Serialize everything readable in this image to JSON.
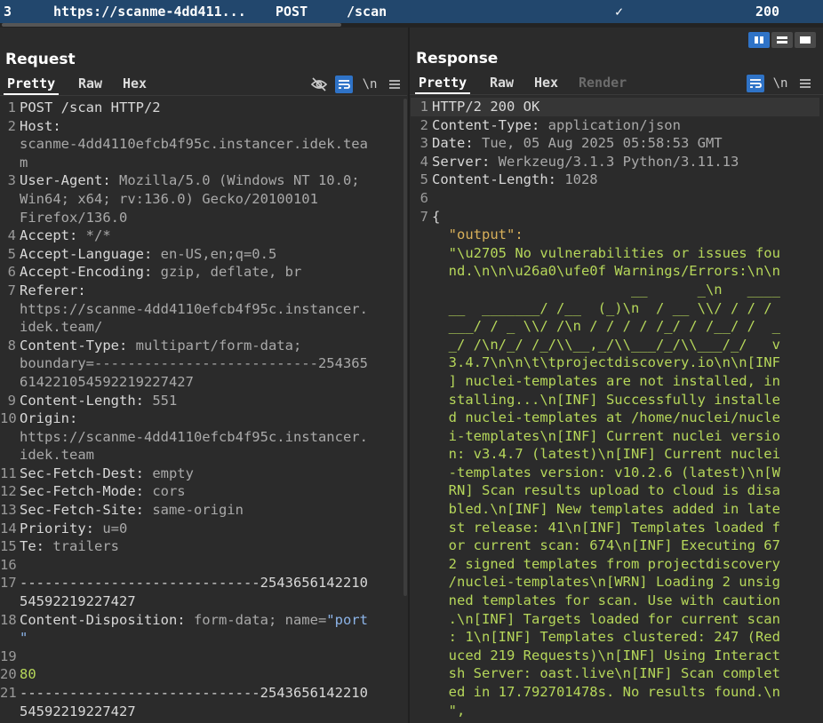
{
  "history_row": {
    "index": "3",
    "host": "https://scanme-4dd411...",
    "method": "POST",
    "path": "/scan",
    "edited_mark": "✓",
    "status": "200"
  },
  "layout_toggle": [
    "side-by-side",
    "stacked",
    "tabs"
  ],
  "request": {
    "title": "Request",
    "tabs": [
      "Pretty",
      "Raw",
      "Hex"
    ],
    "active_tab": "Pretty",
    "icons": [
      "hide-nonprintable-icon",
      "wrap-lines-icon",
      "newline-icon",
      "menu-icon"
    ],
    "newline_label": "\\n",
    "line_numbers": [
      "1",
      "2",
      "",
      "",
      "3",
      "",
      "",
      "4",
      "5",
      "6",
      "7",
      "",
      "",
      "8",
      "",
      "",
      "9",
      "10",
      "",
      "",
      "11",
      "12",
      "13",
      "14",
      "15",
      "16",
      "17",
      "",
      "18",
      "",
      "19",
      "20",
      "21",
      ""
    ],
    "lines": [
      [
        [
          "POST /scan HTTP/2",
          "hname"
        ]
      ],
      [
        [
          "Host:",
          "hname"
        ]
      ],
      [
        [
          "scanme-4dd4110efcb4f95c.instancer.idek.tea",
          "hval"
        ]
      ],
      [
        [
          "m",
          "hval"
        ]
      ],
      [
        [
          "User-Agent:",
          "hname"
        ],
        [
          " Mozilla/5.0 (Windows NT 10.0;",
          "hval"
        ]
      ],
      [
        [
          "Win64; x64; rv:136.0) Gecko/20100101",
          "hval"
        ]
      ],
      [
        [
          "Firefox/136.0",
          "hval"
        ]
      ],
      [
        [
          "Accept:",
          "hname"
        ],
        [
          " */*",
          "hval"
        ]
      ],
      [
        [
          "Accept-Language:",
          "hname"
        ],
        [
          " en-US,en;q=0.5",
          "hval"
        ]
      ],
      [
        [
          "Accept-Encoding:",
          "hname"
        ],
        [
          " gzip, deflate, br",
          "hval"
        ]
      ],
      [
        [
          "Referer:",
          "hname"
        ]
      ],
      [
        [
          "https://scanme-4dd4110efcb4f95c.instancer.",
          "hval"
        ]
      ],
      [
        [
          "idek.team/",
          "hval"
        ]
      ],
      [
        [
          "Content-Type:",
          "hname"
        ],
        [
          " multipart/form-data;",
          "hval"
        ]
      ],
      [
        [
          "boundary=---------------------------254365",
          "hval"
        ]
      ],
      [
        [
          "614221054592219227427",
          "hval"
        ]
      ],
      [
        [
          "Content-Length:",
          "hname"
        ],
        [
          " 551",
          "hval"
        ]
      ],
      [
        [
          "Origin:",
          "hname"
        ]
      ],
      [
        [
          "https://scanme-4dd4110efcb4f95c.instancer.",
          "hval"
        ]
      ],
      [
        [
          "idek.team",
          "hval"
        ]
      ],
      [
        [
          "Sec-Fetch-Dest:",
          "hname"
        ],
        [
          " empty",
          "hval"
        ]
      ],
      [
        [
          "Sec-Fetch-Mode:",
          "hname"
        ],
        [
          " cors",
          "hval"
        ]
      ],
      [
        [
          "Sec-Fetch-Site:",
          "hname"
        ],
        [
          " same-origin",
          "hval"
        ]
      ],
      [
        [
          "Priority:",
          "hname"
        ],
        [
          " u=0",
          "hval"
        ]
      ],
      [
        [
          "Te:",
          "hname"
        ],
        [
          " trailers",
          "hval"
        ]
      ],
      [
        [
          "",
          "plain"
        ]
      ],
      [
        [
          "-----------------------------2543656142210",
          "plain"
        ]
      ],
      [
        [
          "54592219227427",
          "plain"
        ]
      ],
      [
        [
          "Content-Disposition:",
          "hname"
        ],
        [
          " form-data; name=",
          "hval"
        ],
        [
          "\"port",
          "attr"
        ]
      ],
      [
        [
          "\"",
          "attr"
        ]
      ],
      [
        [
          "",
          "plain"
        ]
      ],
      [
        [
          "80",
          "green"
        ]
      ],
      [
        [
          "-----------------------------2543656142210",
          "plain"
        ]
      ],
      [
        [
          "54592219227427",
          "plain"
        ]
      ]
    ]
  },
  "response": {
    "title": "Response",
    "tabs": [
      "Pretty",
      "Raw",
      "Hex",
      "Render"
    ],
    "active_tab": "Pretty",
    "icons": [
      "wrap-lines-icon",
      "newline-icon",
      "menu-icon"
    ],
    "newline_label": "\\n",
    "line_numbers": [
      "1",
      "2",
      "3",
      "4",
      "5",
      "6",
      "7",
      "",
      "",
      "",
      "",
      "",
      "",
      "",
      "",
      "",
      "",
      "",
      "",
      "",
      "",
      "",
      "",
      "",
      "",
      "",
      "",
      "",
      "",
      "",
      "",
      "",
      "",
      "",
      "",
      "",
      "",
      "",
      "",
      ""
    ],
    "lines": [
      [
        [
          "HTTP/2 200 OK",
          "hname"
        ]
      ],
      [
        [
          "Content-Type:",
          "hname"
        ],
        [
          " application/json",
          "hval"
        ]
      ],
      [
        [
          "Date:",
          "hname"
        ],
        [
          " Tue, 05 Aug 2025 05:58:53 GMT",
          "hval"
        ]
      ],
      [
        [
          "Server:",
          "hname"
        ],
        [
          " Werkzeug/3.1.3 Python/3.11.13",
          "hval"
        ]
      ],
      [
        [
          "Content-Length:",
          "hname"
        ],
        [
          " 1028",
          "hval"
        ]
      ],
      [
        [
          "",
          "plain"
        ]
      ],
      [
        [
          "{",
          "plain"
        ]
      ],
      [
        [
          "  \"output\":",
          "json-key"
        ]
      ],
      [
        [
          "  \"\\u2705 No vulnerabilities or issues fou",
          "green"
        ]
      ],
      [
        [
          "  nd.\\n\\n\\u26a0\\ufe0f Warnings/Errors:\\n\\n",
          "green"
        ]
      ],
      [
        [
          "                        __      _\\n   ____",
          "green"
        ]
      ],
      [
        [
          "  __  _______/ /__  (_)\\n  / __ \\\\/ / / /",
          "green"
        ]
      ],
      [
        [
          "  ___/ / _ \\\\/ /\\n / / / / /_/ / /__/ /  _",
          "green"
        ]
      ],
      [
        [
          "  _/ /\\n/_/ /_/\\\\__,_/\\\\___/_/\\\\___/_/   v",
          "green"
        ]
      ],
      [
        [
          "  3.4.7\\n\\n\\t\\tprojectdiscovery.io\\n\\n[INF",
          "green"
        ]
      ],
      [
        [
          "  ] nuclei-templates are not installed, in",
          "green"
        ]
      ],
      [
        [
          "  stalling...\\n[INF] Successfully installe",
          "green"
        ]
      ],
      [
        [
          "  d nuclei-templates at /home/nuclei/nucle",
          "green"
        ]
      ],
      [
        [
          "  i-templates\\n[INF] Current nuclei versio",
          "green"
        ]
      ],
      [
        [
          "  n: v3.4.7 (latest)\\n[INF] Current nuclei",
          "green"
        ]
      ],
      [
        [
          "  -templates version: v10.2.6 (latest)\\n[W",
          "green"
        ]
      ],
      [
        [
          "  RN] Scan results upload to cloud is disa",
          "green"
        ]
      ],
      [
        [
          "  bled.\\n[INF] New templates added in late",
          "green"
        ]
      ],
      [
        [
          "  st release: 41\\n[INF] Templates loaded f",
          "green"
        ]
      ],
      [
        [
          "  or current scan: 674\\n[INF] Executing 67",
          "green"
        ]
      ],
      [
        [
          "  2 signed templates from projectdiscovery",
          "green"
        ]
      ],
      [
        [
          "  /nuclei-templates\\n[WRN] Loading 2 unsig",
          "green"
        ]
      ],
      [
        [
          "  ned templates for scan. Use with caution",
          "green"
        ]
      ],
      [
        [
          "  .\\n[INF] Targets loaded for current scan",
          "green"
        ]
      ],
      [
        [
          "  : 1\\n[INF] Templates clustered: 247 (Red",
          "green"
        ]
      ],
      [
        [
          "  uced 219 Requests)\\n[INF] Using Interact",
          "green"
        ]
      ],
      [
        [
          "  sh Server: oast.live\\n[INF] Scan complet",
          "green"
        ]
      ],
      [
        [
          "  ed in 17.792701478s. No results found.\\n",
          "green"
        ]
      ],
      [
        [
          "  \",",
          "green"
        ]
      ]
    ]
  }
}
